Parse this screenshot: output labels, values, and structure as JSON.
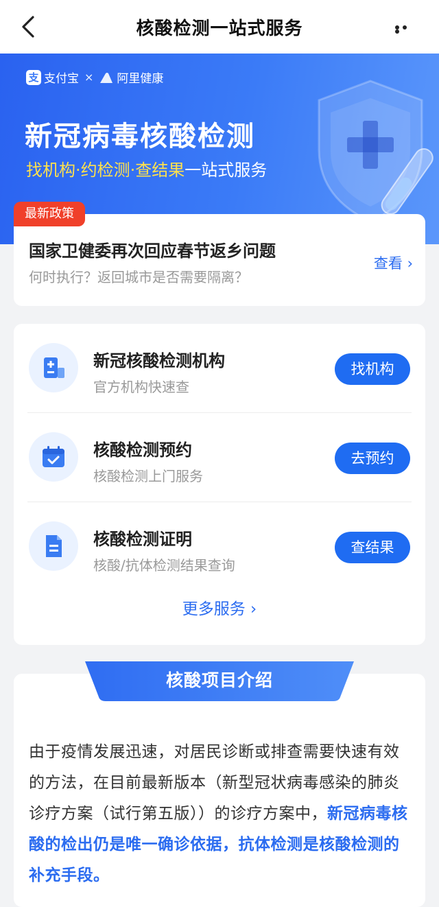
{
  "nav": {
    "title": "核酸检测一站式服务"
  },
  "banner": {
    "brand_alipay": "支付宝",
    "brand_alipay_logo_char": "支",
    "brand_cross": "×",
    "brand_ali_health": "阿里健康",
    "headline": "新冠病毒核酸检测",
    "sub_highlight": "找机构·约检测·查结果",
    "sub_rest": "一站式服务"
  },
  "policy": {
    "tag": "最新政策",
    "title": "国家卫健委再次回应春节返乡问题",
    "subtitle": "何时执行？返回城市是否需要隔离？",
    "view_label": "查看 ›"
  },
  "services": {
    "items": [
      {
        "title": "新冠核酸检测机构",
        "subtitle": "官方机构快速查",
        "button": "找机构",
        "icon": "institution-icon"
      },
      {
        "title": "核酸检测预约",
        "subtitle": "核酸检测上门服务",
        "button": "去预约",
        "icon": "calendar-icon"
      },
      {
        "title": "核酸检测证明",
        "subtitle": "核酸/抗体检测结果查询",
        "button": "查结果",
        "icon": "document-icon"
      }
    ],
    "more_label": "更多服务 ›"
  },
  "intro": {
    "title": "核酸项目介绍",
    "para_normal": "由于疫情发展迅速，对居民诊断或排查需要快速有效的方法，在目前最新版本（新型冠状病毒感染的肺炎诊疗方案（试行第五版））的诊疗方案中，",
    "para_emphasis": "新冠病毒核酸的检出仍是唯一确诊依据，抗体检测是核酸检测的补充手段。"
  },
  "colors": {
    "primary": "#1f6cf2",
    "banner_start": "#2a62f0",
    "banner_end": "#5b97fb",
    "tag_red": "#f0402a",
    "highlight_yellow": "#ffe14d",
    "link_blue": "#2b6cf0"
  }
}
